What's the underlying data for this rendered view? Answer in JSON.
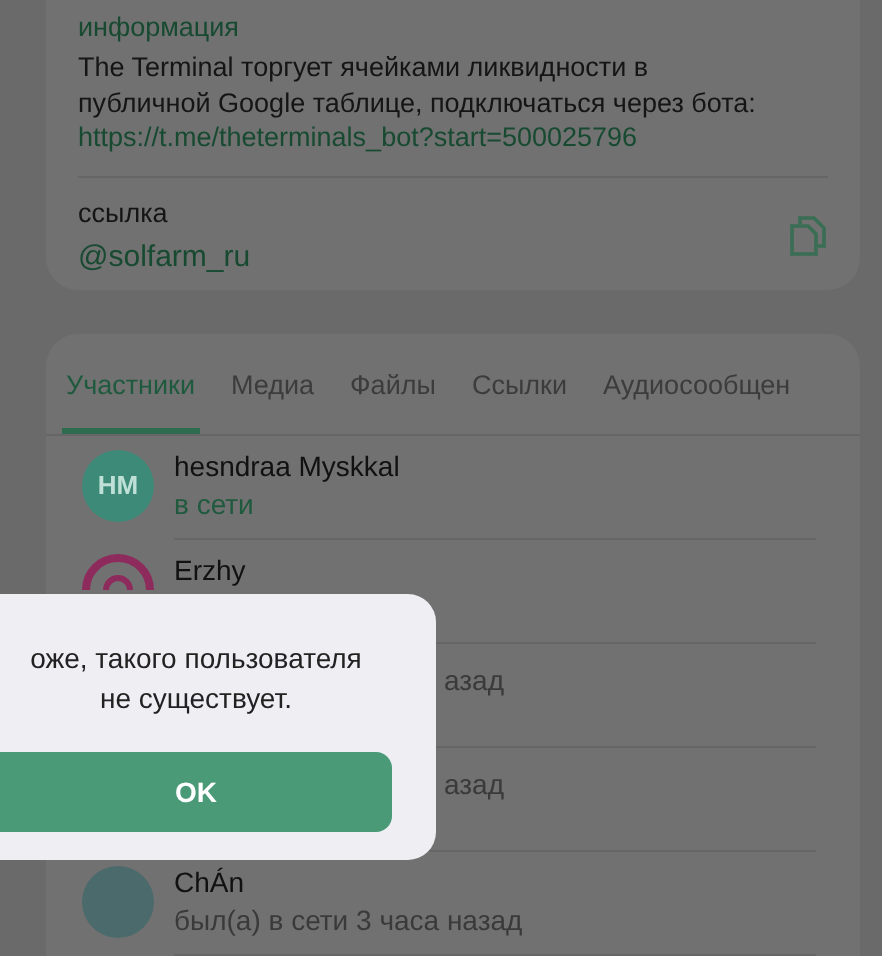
{
  "info": {
    "label": "информация",
    "text": "The Terminal торгует ячейками ликвидности в публичной Google таблице, подключаться через бота:",
    "link": "https://t.me/theterminals_bot?start=500025796"
  },
  "username": {
    "label": "ссылка",
    "value": "@solfarm_ru"
  },
  "tabs": [
    {
      "label": "Участники",
      "selected": true
    },
    {
      "label": "Медиа",
      "selected": false
    },
    {
      "label": "Файлы",
      "selected": false
    },
    {
      "label": "Ссылки",
      "selected": false
    },
    {
      "label": "Аудиосообщен",
      "selected": false
    }
  ],
  "members": [
    {
      "kind": "initials",
      "initials": "HM",
      "name": "hesndraa Myskkal",
      "status": "в сети",
      "online": true
    },
    {
      "kind": "logo",
      "name": "Erzhy"
    },
    {
      "kind": "hidden",
      "status": "азад",
      "online": false
    },
    {
      "kind": "hidden",
      "status": "азад",
      "online": false
    },
    {
      "kind": "photo",
      "name": "ChÁn",
      "status": "был(а) в сети 3 часа назад",
      "online": false
    }
  ],
  "dialog": {
    "message": "оже, такого пользователя не существует.",
    "button": "OK"
  }
}
